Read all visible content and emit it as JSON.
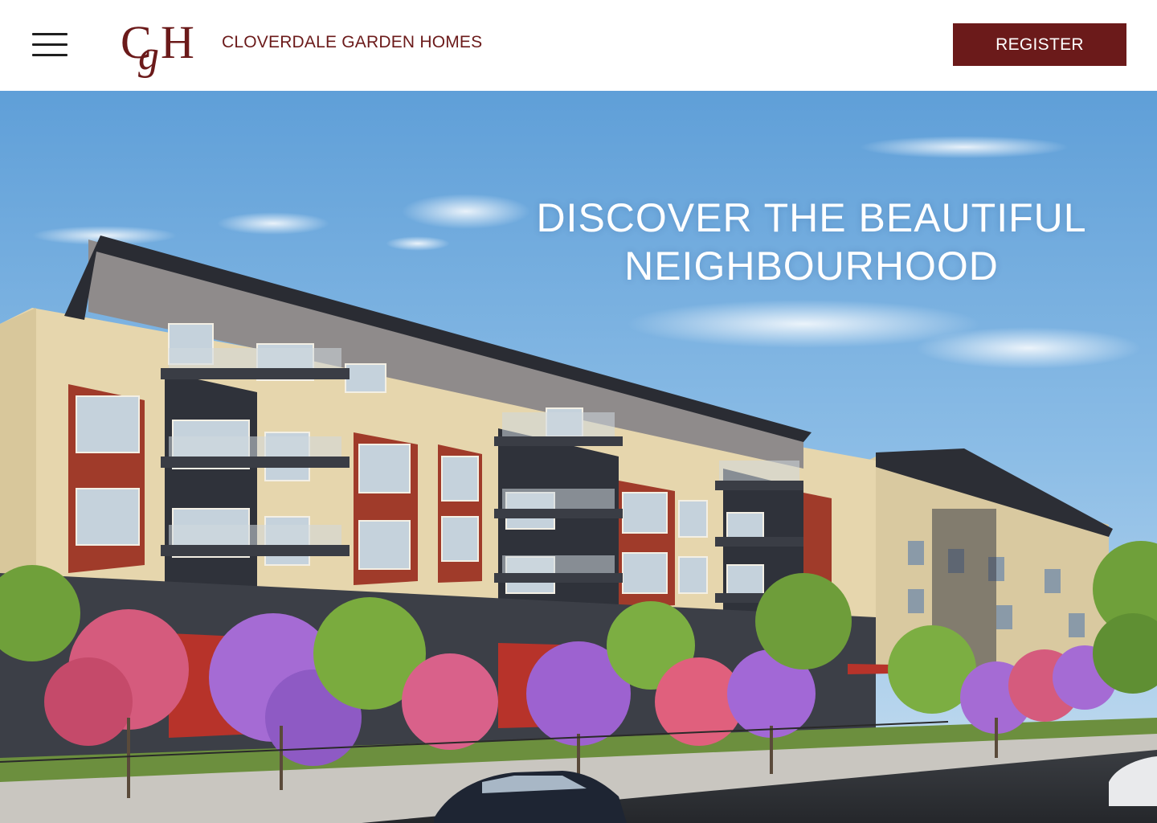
{
  "header": {
    "logo_letters": "CgH",
    "brand_name": "CLOVERDALE GARDEN HOMES",
    "register_label": "REGISTER",
    "brand_color": "#6b1a1a"
  },
  "hero": {
    "title_line1": "DISCOVER THE BEAUTIFUL",
    "title_line2": "NEIGHBOURHOOD"
  },
  "icons": {
    "menu": "hamburger-menu-icon"
  }
}
